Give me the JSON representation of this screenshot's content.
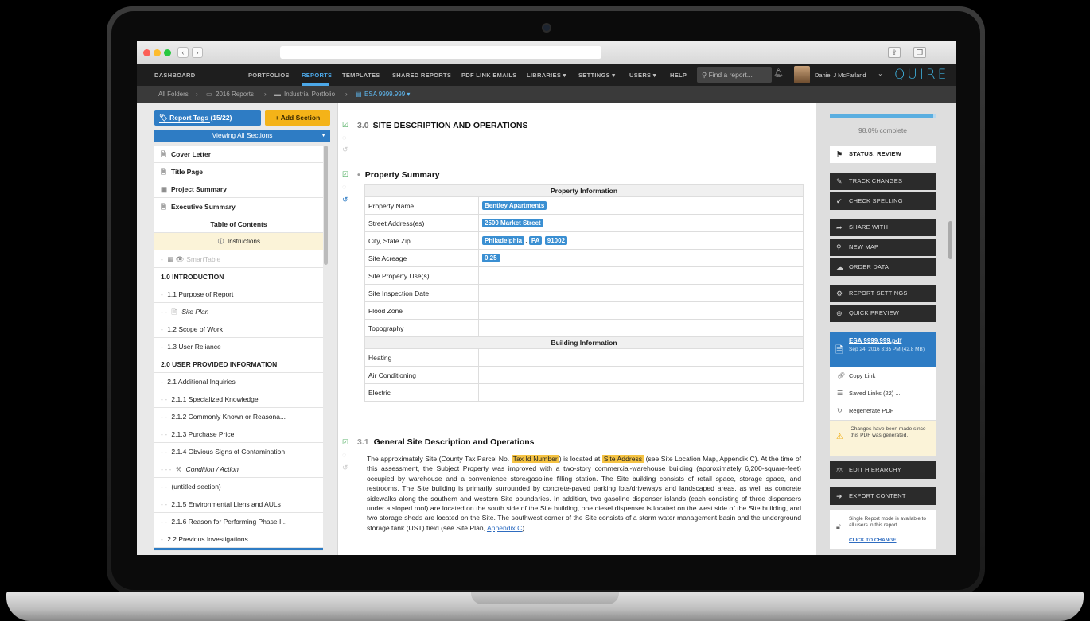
{
  "browser": {
    "back": "‹",
    "forward": "›",
    "share_icon": "share-icon",
    "tabs_icon": "tabs-icon"
  },
  "nav": {
    "items": [
      "DASHBOARD",
      "PORTFOLIOS",
      "REPORTS",
      "TEMPLATES",
      "SHARED REPORTS",
      "PDF LINK EMAILS",
      "LIBRARIES ▾",
      "SETTINGS ▾",
      "USERS ▾",
      "HELP"
    ],
    "active": "REPORTS",
    "search_placeholder": "Find a report...",
    "user": "Daniel J McFarland",
    "logo": "QUIRE",
    "accent": "#4ca8e8"
  },
  "breadcrumb": {
    "items": [
      "All Folders",
      "2016 Reports",
      "Industrial Portfolio"
    ],
    "current": "ESA 9999.999 ▾",
    "sep": "›"
  },
  "sidebar": {
    "tags_label": "Report Tags (15/22)",
    "add_section": "+ Add Section",
    "viewing": "Viewing All Sections",
    "outline": [
      {
        "label": "Cover Letter",
        "style": "bold",
        "icon": "doc"
      },
      {
        "label": "Title Page",
        "style": "bold",
        "icon": "doc"
      },
      {
        "label": "Project Summary",
        "style": "bold",
        "icon": "table"
      },
      {
        "label": "Executive Summary",
        "style": "bold",
        "icon": "doc"
      },
      {
        "label": "Table of Contents",
        "style": "bold-center",
        "icon": ""
      },
      {
        "label": "Instructions",
        "style": "instr",
        "icon": "info"
      },
      {
        "label": "SmartTable",
        "style": "muted",
        "icon": "hidden"
      },
      {
        "label": "1.0 INTRODUCTION",
        "style": "bold",
        "icon": ""
      },
      {
        "label": "1.1 Purpose of Report",
        "style": "level1",
        "icon": ""
      },
      {
        "label": "Site Plan",
        "style": "italic-level2",
        "icon": "doc"
      },
      {
        "label": "1.2 Scope of Work",
        "style": "level1",
        "icon": ""
      },
      {
        "label": "1.3 User Reliance",
        "style": "level1",
        "icon": ""
      },
      {
        "label": "2.0 USER PROVIDED INFORMATION",
        "style": "bold",
        "icon": ""
      },
      {
        "label": "2.1 Additional Inquiries",
        "style": "level1",
        "icon": ""
      },
      {
        "label": "2.1.1 Specialized Knowledge",
        "style": "level2",
        "icon": ""
      },
      {
        "label": "2.1.2 Commonly Known or Reasona...",
        "style": "level2",
        "icon": ""
      },
      {
        "label": "2.1.3 Purchase Price",
        "style": "level2",
        "icon": ""
      },
      {
        "label": "2.1.4 Obvious Signs of Contamination",
        "style": "level2",
        "icon": ""
      },
      {
        "label": "Condition / Action",
        "style": "italic-level3",
        "icon": "wrench"
      },
      {
        "label": "(untitled section)",
        "style": "level2",
        "icon": ""
      },
      {
        "label": "2.1.5 Environmental Liens and AULs",
        "style": "level2",
        "icon": ""
      },
      {
        "label": "2.1.6 Reason for Performing Phase I...",
        "style": "level2",
        "icon": ""
      },
      {
        "label": "2.2 Previous Investigations",
        "style": "level1",
        "icon": ""
      }
    ]
  },
  "doc": {
    "section_num": "3.0",
    "section_title": "SITE DESCRIPTION AND OPERATIONS",
    "subsection_title": "Property Summary",
    "table": {
      "head1": "Property Information",
      "rows1": [
        {
          "k": "Property Name",
          "tags": [
            "Bentley Apartments"
          ]
        },
        {
          "k": "Street Address(es)",
          "tags": [
            "2500 Market Street"
          ]
        },
        {
          "k": "City, State Zip",
          "tags": [
            "Philadelphia",
            "PA",
            "91002"
          ]
        },
        {
          "k": "Site Acreage",
          "tags": [
            "0.25"
          ]
        },
        {
          "k": "Site Property Use(s)",
          "tags": []
        },
        {
          "k": "Site Inspection Date",
          "tags": []
        },
        {
          "k": "Flood Zone",
          "tags": []
        },
        {
          "k": "Topography",
          "tags": []
        }
      ],
      "head2": "Building Information",
      "rows2": [
        "Heating",
        "Air Conditioning",
        "Electric"
      ]
    },
    "sub2_num": "3.1",
    "sub2_title": "General Site Description and Operations",
    "para": {
      "p1": "The approximately Site (County Tax Parcel No.",
      "tag1": "Tax Id Number",
      "p2": ") is located at",
      "tag2": "Site Address",
      "p3": "(see Site Location Map, Appendix C).  At the time of this assessment, the Subject Property was improved with a two-story commercial-warehouse building (approximately 6,200-square-feet) occupied by warehouse and a convenience store/gasoline filling station.  The Site building consists of retail space, storage space, and restrooms.  The Site building is primarily surrounded by concrete-paved parking lots/driveways and landscaped areas, as well as concrete sidewalks along the southern and western Site boundaries.  In addition, two gasoline dispenser islands (each consisting of three dispensers under a sloped roof) are located on the south side of the Site building, one diesel dispenser is located on the west side of the Site building, and two storage sheds are located on the Site.  The southwest corner of the Site consists of a storm water management basin and the underground storage tank (UST) field (see Site Plan,",
      "link": "Appendix C",
      "p4": ")."
    }
  },
  "right": {
    "progress": 0.98,
    "progress_label": "98.0% complete",
    "status": "STATUS: REVIEW",
    "track_changes": "TRACK CHANGES",
    "check_spelling": "CHECK SPELLING",
    "share_with": "SHARE WITH",
    "new_map": "NEW MAP",
    "order_data": "ORDER DATA",
    "report_settings": "REPORT SETTINGS",
    "quick_preview": "QUICK PREVIEW",
    "pdf_name": "ESA 9999.999.pdf",
    "pdf_meta": "Sep 24, 2016 3:35 PM (42.8 MB)",
    "copy_link": "Copy Link",
    "saved_links": "Saved Links (22) ...",
    "regenerate": "Regenerate PDF",
    "warning": "Changes have been made since this PDF was generated.",
    "edit_hierarchy": "EDIT HIERARCHY",
    "export_content": "EXPORT CONTENT",
    "mode_text": "Single Report mode is available to all users in this report.",
    "mode_link": "CLICK TO CHANGE"
  }
}
